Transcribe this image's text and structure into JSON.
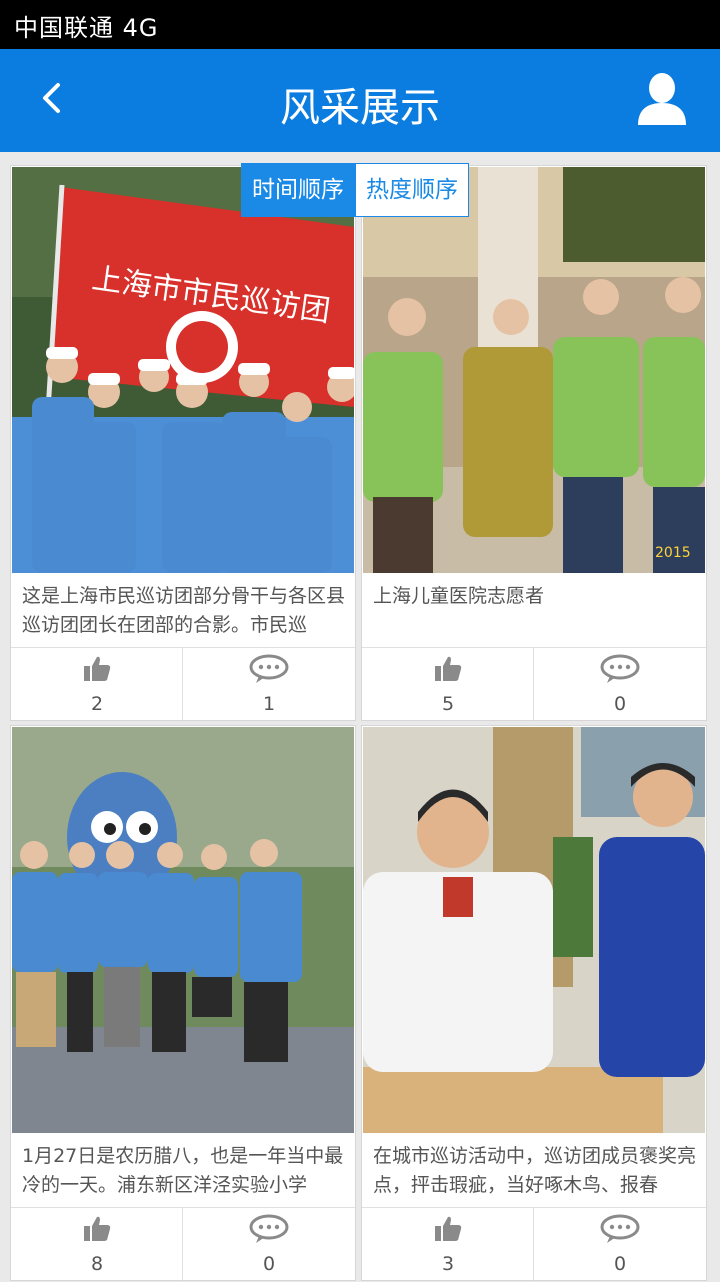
{
  "status_bar": {
    "carrier": "中国联通 4G"
  },
  "header": {
    "title": "风采展示",
    "back_icon": "chevron-left-icon",
    "user_icon": "user-icon"
  },
  "sort_tabs": [
    {
      "label": "时间顺序",
      "active": true
    },
    {
      "label": "热度顺序",
      "active": false
    }
  ],
  "cards": [
    {
      "caption": "这是上海市民巡访团部分骨干与各区县巡访团团长在团部的合影。市民巡",
      "likes": "2",
      "comments": "1",
      "photo_text": "上海市市民巡访团"
    },
    {
      "caption": "上海儿童医院志愿者",
      "likes": "5",
      "comments": "0",
      "photo_text": "2015"
    },
    {
      "caption": "1月27日是农历腊八，也是一年当中最冷的一天。浦东新区洋泾实验小学",
      "likes": "8",
      "comments": "0",
      "photo_text": ""
    },
    {
      "caption": "在城市巡访活动中，巡访团成员褒奖亮点，抨击瑕疵，当好啄木鸟、报春",
      "likes": "3",
      "comments": "0",
      "photo_text": ""
    }
  ],
  "colors": {
    "primary": "#0b7de0",
    "tab_active": "#1a8ae6",
    "status_bar": "#000000"
  }
}
